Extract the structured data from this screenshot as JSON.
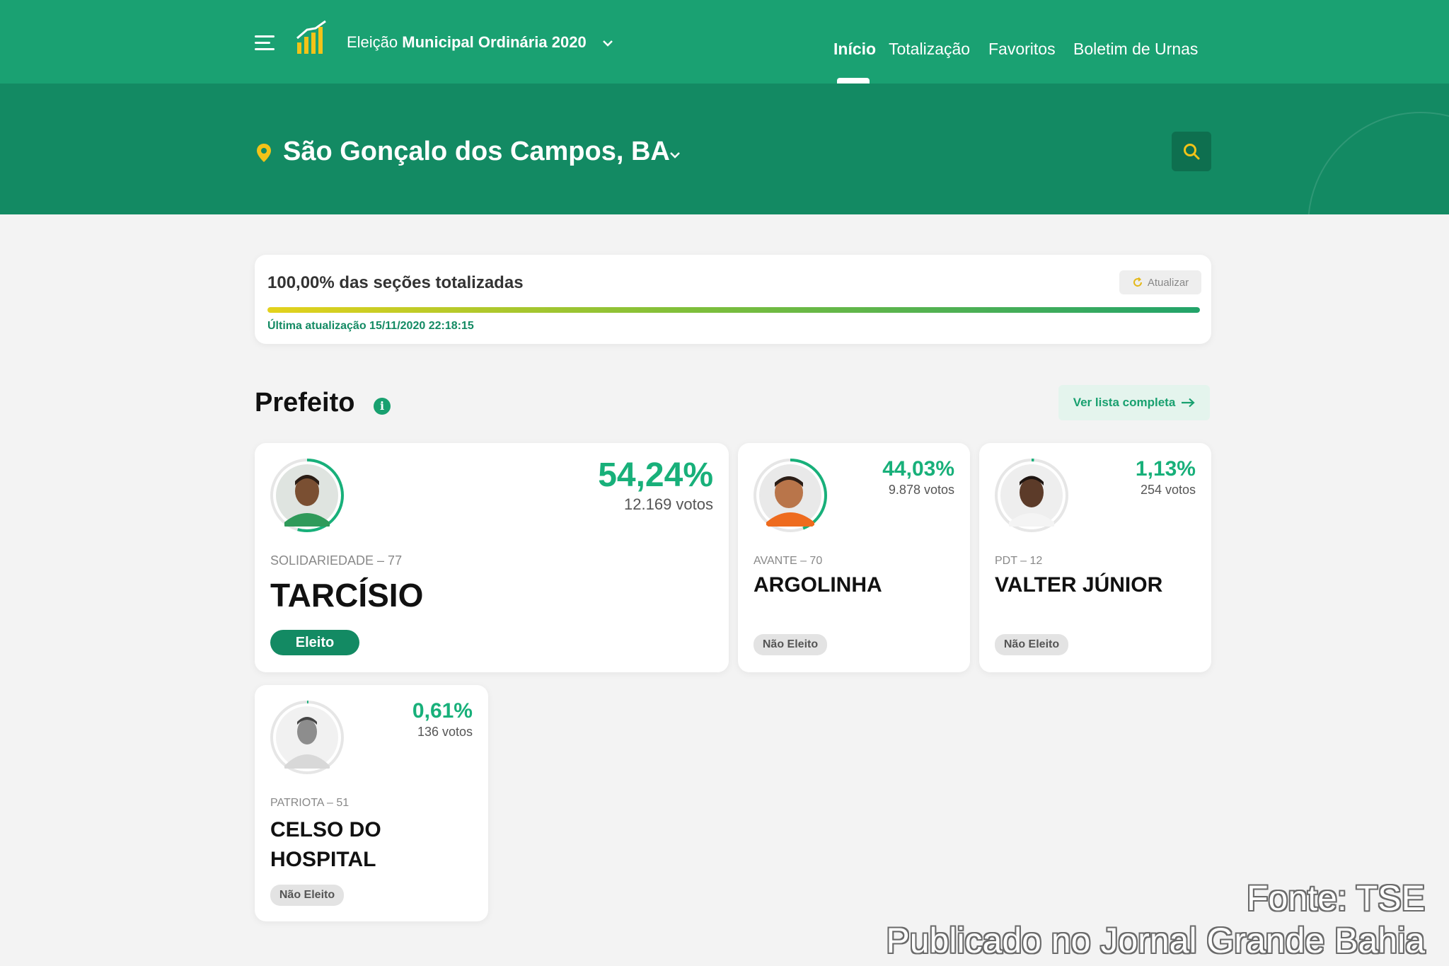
{
  "header": {
    "election_prefix": "Eleição",
    "election_name": "Municipal Ordinária 2020",
    "nav": [
      "Início",
      "Totalização",
      "Favoritos",
      "Boletim de Urnas"
    ]
  },
  "location": {
    "city": "São Gonçalo dos Campos, BA"
  },
  "totalization": {
    "label": "100,00% das seções totalizadas",
    "progress_percent": 100,
    "refresh_label": "Atualizar",
    "last_update": "Última atualização 15/11/2020 22:18:15"
  },
  "section": {
    "title": "Prefeito",
    "info_glyph": "i",
    "list_button": "Ver lista completa"
  },
  "candidates": [
    {
      "percent": "54,24%",
      "votes": "12.169 votos",
      "party": "SOLIDARIEDADE – 77",
      "name": "TARCÍSIO",
      "status": "Eleito",
      "share": 0.5424
    },
    {
      "percent": "44,03%",
      "votes": "9.878 votos",
      "party": "AVANTE – 70",
      "name": "ARGOLINHA",
      "status": "Não Eleito",
      "share": 0.4403
    },
    {
      "percent": "1,13%",
      "votes": "254 votos",
      "party": "PDT – 12",
      "name": "VALTER JÚNIOR",
      "status": "Não Eleito",
      "share": 0.0113
    },
    {
      "percent": "0,61%",
      "votes": "136 votos",
      "party": "PATRIOTA – 51",
      "name": "CELSO DO HOSPITAL",
      "status": "Não Eleito",
      "share": 0.0061
    }
  ],
  "colors": {
    "header": "#1aa172",
    "hero": "#138a63",
    "accent": "#18b07a",
    "pin": "#f2c318"
  },
  "icons": [
    "menu-icon",
    "bar-chart-logo-icon",
    "chevron-down-icon",
    "location-pin-icon",
    "search-icon",
    "refresh-icon",
    "info-icon",
    "arrow-right-icon"
  ],
  "source": {
    "line1": "Fonte: TSE",
    "line2": "Publicado no Jornal Grande Bahia"
  }
}
